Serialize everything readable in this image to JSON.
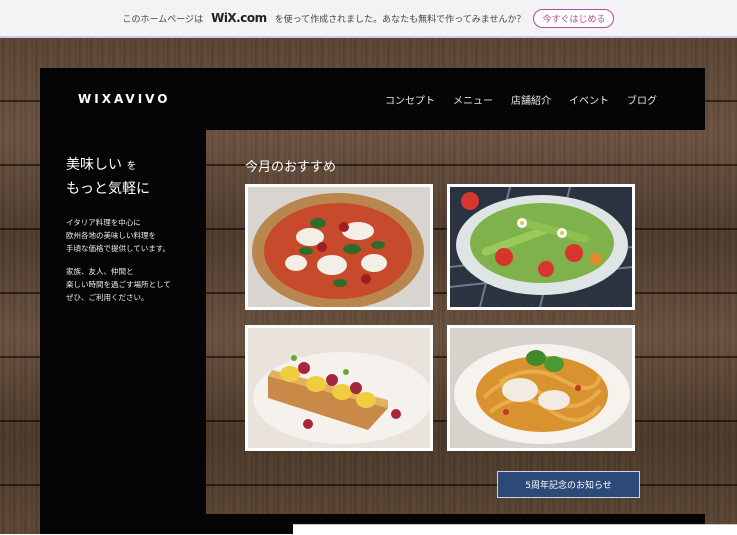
{
  "banner": {
    "text_before": "このホームページは",
    "wix": "WiX.com",
    "text_after": "を使って作成されました。あなたも無料で作ってみませんか？",
    "cta": "今すぐはじめる"
  },
  "header": {
    "logo": "WIXAVIVO",
    "nav": [
      "コンセプト",
      "メニュー",
      "店舗紹介",
      "イベント",
      "ブログ"
    ]
  },
  "sidebar": {
    "title_line1": "美味しい",
    "title_line1_small": "を",
    "title_line2": "もっと気軽に",
    "para1": "イタリア料理を中心に\n欧州各地の美味しい料理を\n手頃な価格で提供しています。",
    "para2": "家族、友人、仲間と\n楽しい時間を過ごす場所として\nぜひ、ご利用ください。"
  },
  "main": {
    "title": "今月のおすすめ",
    "notice_button": "5周年記念のお知らせ"
  }
}
